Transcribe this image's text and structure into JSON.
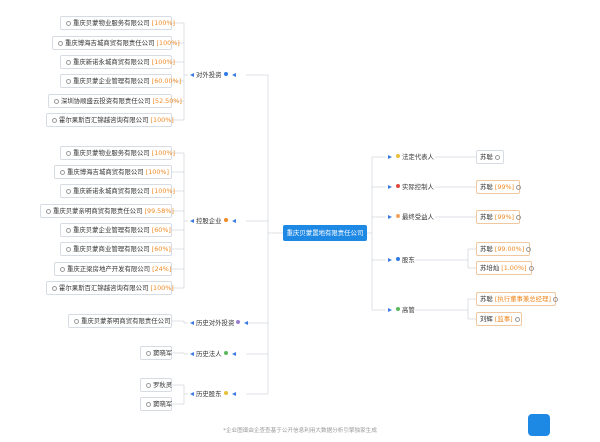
{
  "center": "重庆贝蒙置地有限责任公司",
  "left": {
    "invest_out": {
      "label": "对外投资",
      "items": [
        {
          "name": "重庆贝蒙物业服务有限公司",
          "pct": "[100%]"
        },
        {
          "name": "重庆博海吉城商贸有限责任公司",
          "pct": "[100%]"
        },
        {
          "name": "重庆新诺永城商贸有限公司",
          "pct": "[100%]"
        },
        {
          "name": "重庆贝蒙企业管理有限公司",
          "pct": "[60.00%]"
        },
        {
          "name": "深圳协顺盛云投资有限责任公司",
          "pct": "[52.50%]"
        },
        {
          "name": "霍尔果斯百汇锦越咨询有限公司",
          "pct": "[100%]"
        }
      ]
    },
    "holding": {
      "label": "控股企业",
      "items": [
        {
          "name": "重庆贝蒙物业服务有限公司",
          "pct": "[100%]"
        },
        {
          "name": "重庆博海吉城商贸有限公司",
          "pct": "[100%]"
        },
        {
          "name": "重庆新诺永城商贸有限公司",
          "pct": "[100%]"
        },
        {
          "name": "重庆贝蒙亲明商贸有限责任公司",
          "pct": "[99.58%]"
        },
        {
          "name": "重庆贝蒙企业管理有限公司",
          "pct": "[60%]"
        },
        {
          "name": "重庆贝蒙商业管理有限公司",
          "pct": "[60%]"
        },
        {
          "name": "重庆正梁房地产开发有限公司",
          "pct": "[24%]"
        },
        {
          "name": "霍尔果斯百汇锦越咨询有限公司",
          "pct": "[100%]"
        }
      ]
    },
    "hist_invest": {
      "label": "历史对外投资",
      "items": [
        {
          "name": "重庆贝蒙茶明商贸有限责任公司",
          "pct": ""
        }
      ]
    },
    "hist_legal": {
      "label": "历史法人",
      "items": [
        {
          "name": "窦晓军",
          "pct": ""
        }
      ]
    },
    "hist_holder": {
      "label": "历史股东",
      "items": [
        {
          "name": "罗秋灵",
          "pct": ""
        },
        {
          "name": "窦晓军",
          "pct": ""
        }
      ]
    }
  },
  "right": {
    "legal_rep": {
      "label": "法定代表人",
      "items": [
        {
          "name": "苏聪",
          "pct": ""
        }
      ]
    },
    "actual_ctrl": {
      "label": "实际控制人",
      "items": [
        {
          "name": "苏聪",
          "pct": "[99%]"
        }
      ]
    },
    "beneficiary": {
      "label": "最终受益人",
      "items": [
        {
          "name": "苏聪",
          "pct": "[99%]"
        }
      ]
    },
    "shareholders": {
      "label": "股东",
      "items": [
        {
          "name": "苏聪",
          "pct": "[99.00%]"
        },
        {
          "name": "苏培灿",
          "pct": "[1.00%]"
        }
      ]
    },
    "executives": {
      "label": "高管",
      "items": [
        {
          "name": "苏聪",
          "pct": "[执行董事兼总经理]"
        },
        {
          "name": "刘辉",
          "pct": "[监事]"
        }
      ]
    }
  },
  "footer": "*企业图谱由企查查基于公开信息利用大数据分析引擎独家生成",
  "colors": {
    "accent": "#1e88e5",
    "line": "#d3d8df",
    "dot_blue": "#2f7be6",
    "dot_orange": "#f08a24",
    "dot_purple": "#9b7fd1",
    "dot_green": "#5cb85c",
    "dot_yellow": "#e8c03a",
    "dot_red": "#e0483e",
    "dot_peach": "#f2a35a"
  }
}
